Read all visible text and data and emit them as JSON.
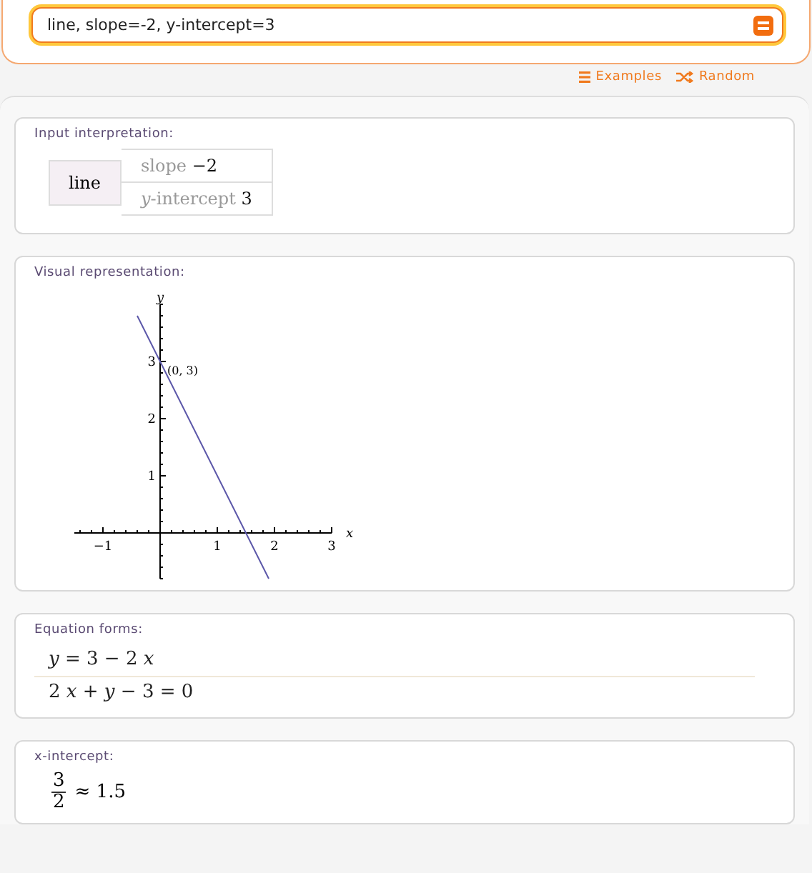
{
  "search": {
    "value": "line, slope=-2, y-intercept=3"
  },
  "links": [
    {
      "kind": "examples",
      "label": "Examples"
    },
    {
      "kind": "random",
      "label": "Random"
    }
  ],
  "pods": [
    {
      "kind": "interpretation",
      "title": "Input interpretation:",
      "head": "line",
      "rows": [
        {
          "label": "slope",
          "value": "−2",
          "italic": false
        },
        {
          "label": "y",
          "suffix": "-intercept",
          "value": "3",
          "italic": true
        }
      ]
    },
    {
      "kind": "plot",
      "title": "Visual representation:",
      "chart_data": {
        "type": "line",
        "xlabel": "x",
        "ylabel": "y",
        "xlim": [
          -1.5,
          3
        ],
        "ylim": [
          -0.8,
          4
        ],
        "xticks": [
          -1,
          1,
          2,
          3
        ],
        "yticks": [
          1,
          2,
          3
        ],
        "series": [
          {
            "color": "#5a56a8",
            "x": [
              -0.4,
              1.9
            ],
            "values": [
              3.8,
              -0.8
            ]
          }
        ],
        "annotations": [
          {
            "x": 0,
            "y": 3,
            "text": "(0, 3)"
          }
        ]
      }
    },
    {
      "kind": "equations",
      "title": "Equation forms:",
      "items": [
        "*y* = 3 − 2 *x*",
        "2 *x* + *y* − 3 = 0"
      ]
    },
    {
      "kind": "fraction",
      "title": "x-intercept:",
      "numerator": "3",
      "denominator": "2",
      "approx": "≈ 1.5"
    }
  ]
}
